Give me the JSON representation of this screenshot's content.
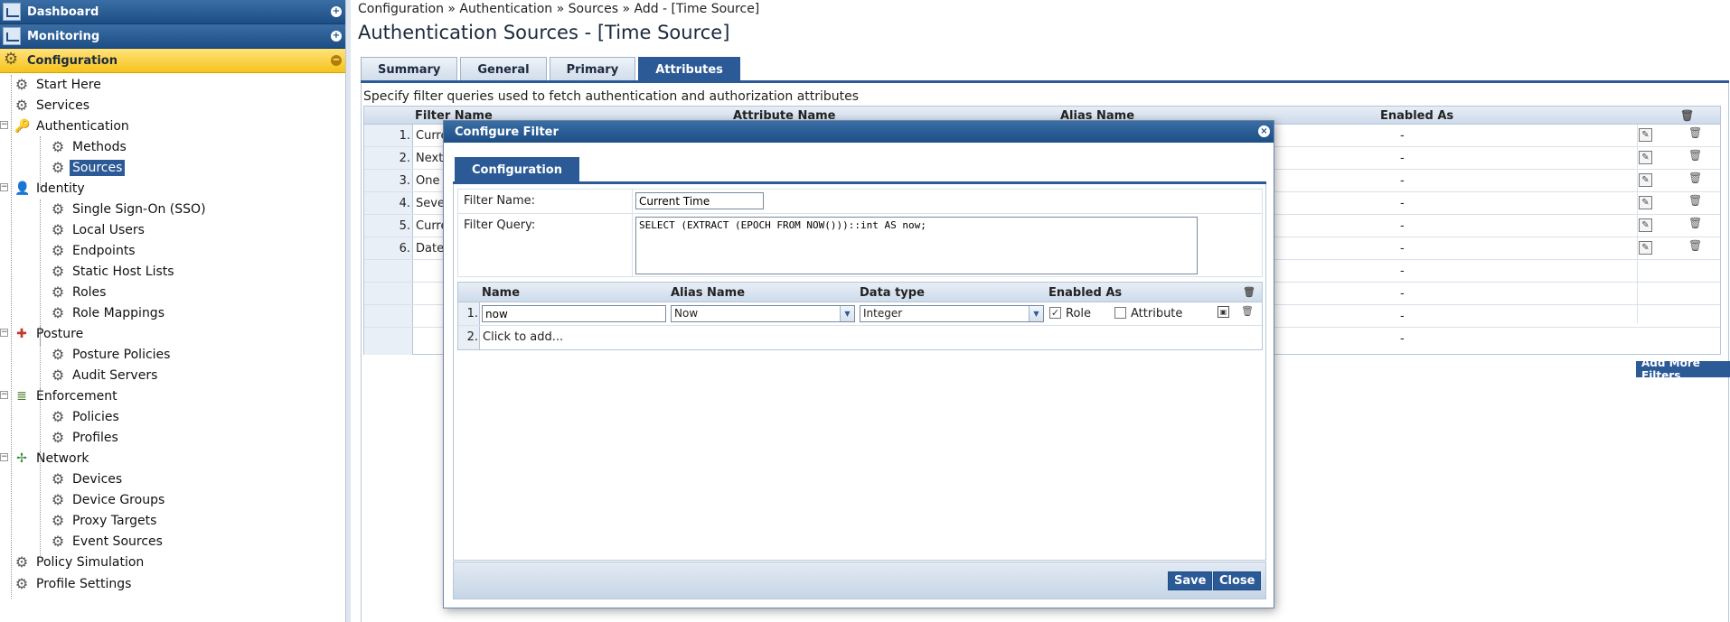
{
  "sidebar": {
    "headers": {
      "dashboard": "Dashboard",
      "monitoring": "Monitoring",
      "configuration": "Configuration"
    },
    "items": {
      "start_here": "Start Here",
      "services": "Services",
      "authentication": "Authentication",
      "methods": "Methods",
      "sources": "Sources",
      "identity": "Identity",
      "sso": "Single Sign-On (SSO)",
      "local_users": "Local Users",
      "endpoints": "Endpoints",
      "static_host_lists": "Static Host Lists",
      "roles": "Roles",
      "role_mappings": "Role Mappings",
      "posture": "Posture",
      "posture_policies": "Posture Policies",
      "audit_servers": "Audit Servers",
      "enforcement": "Enforcement",
      "policies": "Policies",
      "profiles": "Profiles",
      "network": "Network",
      "devices": "Devices",
      "device_groups": "Device Groups",
      "proxy_targets": "Proxy Targets",
      "event_sources": "Event Sources",
      "policy_simulation": "Policy Simulation",
      "profile_settings": "Profile Settings"
    }
  },
  "main": {
    "breadcrumb": "Configuration » Authentication » Sources » Add - [Time Source]",
    "title": "Authentication Sources - [Time Source]",
    "tabs": [
      "Summary",
      "General",
      "Primary",
      "Attributes"
    ],
    "description": "Specify filter queries used to fetch authentication and authorization attributes",
    "filter_table": {
      "headers": {
        "filter_name": "Filter Name",
        "attribute_name": "Attribute Name",
        "alias_name": "Alias Name",
        "enabled_as": "Enabled As"
      },
      "rows": [
        {
          "num": "1.",
          "name": "Curre",
          "enabled": "-"
        },
        {
          "num": "2.",
          "name": "Next",
          "enabled": "-"
        },
        {
          "num": "3.",
          "name": "One",
          "enabled": "-"
        },
        {
          "num": "4.",
          "name": "Seve",
          "enabled": "-"
        },
        {
          "num": "5.",
          "name": "Curre",
          "enabled": "-"
        },
        {
          "num": "6.",
          "name": "Date",
          "enabled": "-"
        },
        {
          "num": "",
          "name": "",
          "enabled": "-"
        },
        {
          "num": "",
          "name": "",
          "enabled": "-"
        },
        {
          "num": "",
          "name": "",
          "enabled": "-"
        },
        {
          "num": "",
          "name": "",
          "enabled": "-"
        }
      ]
    },
    "add_more_filters": "Add More Filters"
  },
  "modal": {
    "title": "Configure Filter",
    "tab": "Configuration",
    "filter_name_label": "Filter Name:",
    "filter_name_value": "Current Time",
    "filter_query_label": "Filter Query:",
    "filter_query_value": "SELECT (EXTRACT (EPOCH FROM NOW()))::int AS now;",
    "attr_table": {
      "headers": {
        "name": "Name",
        "alias": "Alias Name",
        "data_type": "Data type",
        "enabled_as": "Enabled As"
      },
      "row1": {
        "num": "1.",
        "name": "now",
        "alias": "Now",
        "data_type": "Integer",
        "role_label": "Role",
        "role_checked": true,
        "attribute_label": "Attribute",
        "attribute_checked": false
      },
      "row2": {
        "num": "2.",
        "click_to_add": "Click to add..."
      }
    },
    "save_label": "Save",
    "close_label": "Close"
  },
  "colors": {
    "header_blue": "#1d4e85",
    "accent_blue": "#2b5a96",
    "active_yellow": "#f6c31c"
  }
}
